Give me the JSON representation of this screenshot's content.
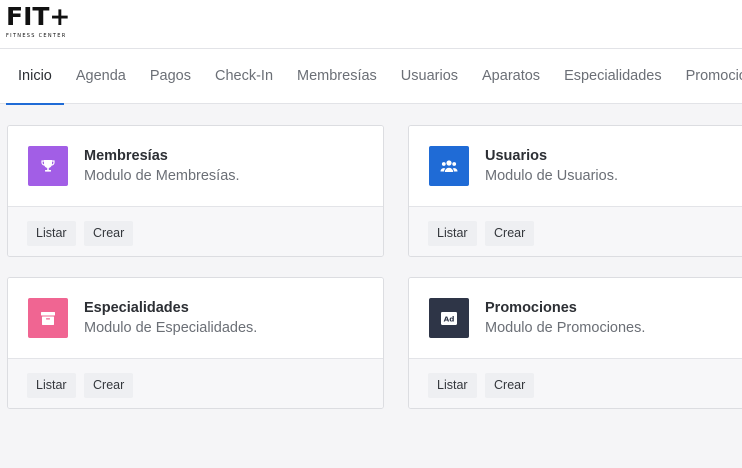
{
  "logo": {
    "main": "FIT+",
    "sub": "FITNESS CENTER"
  },
  "nav": {
    "items": [
      "Inicio",
      "Agenda",
      "Pagos",
      "Check-In",
      "Membresías",
      "Usuarios",
      "Aparatos",
      "Especialidades",
      "Promociones"
    ],
    "active_index": 0,
    "accent": "#1f6bd6"
  },
  "modules": [
    {
      "title": "Membresías",
      "description": "Modulo de Membresías.",
      "icon": "trophy-icon",
      "color": "#a25ee6",
      "list_label": "Listar",
      "create_label": "Crear"
    },
    {
      "title": "Usuarios",
      "description": "Modulo de Usuarios.",
      "icon": "users-icon",
      "color": "#1f6bd6",
      "list_label": "Listar",
      "create_label": "Crear"
    },
    {
      "title": "Especialidades",
      "description": "Modulo de Especialidades.",
      "icon": "archive-icon",
      "color": "#f06592",
      "list_label": "Listar",
      "create_label": "Crear"
    },
    {
      "title": "Promociones",
      "description": "Modulo de Promociones.",
      "icon": "ad-icon",
      "color": "#2e3547",
      "icon_text": "Ad",
      "list_label": "Listar",
      "create_label": "Crear"
    }
  ]
}
